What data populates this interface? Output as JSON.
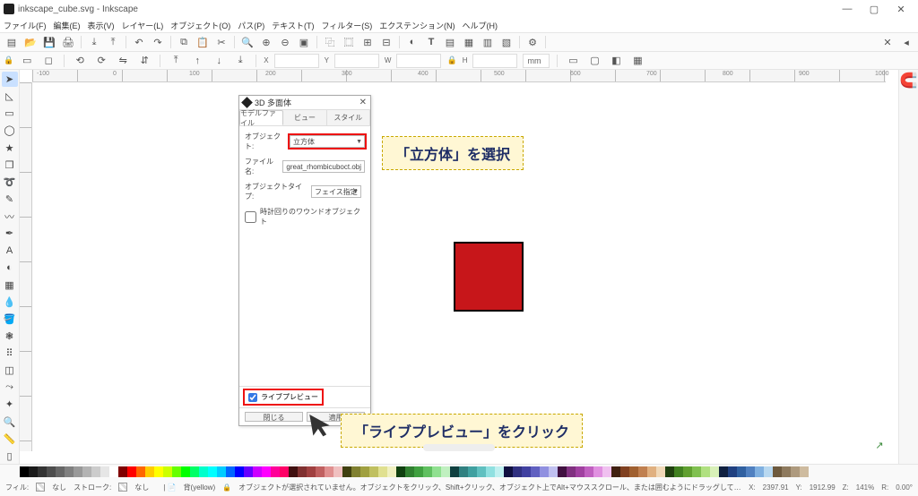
{
  "title": "inkscape_cube.svg - Inkscape",
  "menus": [
    "ファイル(F)",
    "編集(E)",
    "表示(V)",
    "レイヤー(L)",
    "オブジェクト(O)",
    "パス(P)",
    "テキスト(T)",
    "フィルター(S)",
    "エクステンション(N)",
    "ヘルプ(H)"
  ],
  "toolbar2": {
    "x_label": "X",
    "x_val": "",
    "y_label": "Y",
    "y_val": "",
    "w_label": "W",
    "w_val": "",
    "h_label": "H",
    "h_val": "",
    "unit": "mm"
  },
  "ruler_ticks": [
    "-100",
    "0",
    "100",
    "200",
    "300",
    "400",
    "500",
    "600",
    "700",
    "800",
    "900",
    "1000"
  ],
  "dialog": {
    "title": "3D 多面体",
    "tabs": [
      "モデルファイル",
      "ビュー",
      "スタイル"
    ],
    "obj_label": "オブジェクト:",
    "obj_value": "立方体",
    "file_label": "ファイル名:",
    "file_value": "great_rhombicuboct.obj",
    "type_label": "オブジェクトタイプ:",
    "type_value": "フェイス指定",
    "cw_label": "時計回りのワウンドオブジェクト",
    "live_label": "ライブプレビュー",
    "btn_close": "閉じる",
    "btn_apply": "適用"
  },
  "annot1": "「立方体」を選択",
  "annot2": "「ライブプレビュー」をクリック",
  "status": {
    "fill_label": "フィル:",
    "stroke_label": "ストローク:",
    "none1": "なし",
    "none2": "なし",
    "layer": "背(yellow)",
    "msg": "オブジェクトが選択されていません。オブジェクトをクリック、Shift+クリック、オブジェクト上でAlt+マウススクロール、または囲むようにドラッグして選択してください。",
    "coord_x": "2397.91",
    "coord_y": "1912.99",
    "zoom": "141%",
    "rot": "0.00°"
  },
  "palette_colors": [
    "#000000",
    "#1a1a1a",
    "#333333",
    "#4d4d4d",
    "#666666",
    "#808080",
    "#999999",
    "#b3b3b3",
    "#cccccc",
    "#e6e6e6",
    "#ffffff",
    "#800000",
    "#ff0000",
    "#ff6600",
    "#ffcc00",
    "#ffff00",
    "#ccff00",
    "#66ff00",
    "#00ff00",
    "#00ff66",
    "#00ffcc",
    "#00ffff",
    "#00ccff",
    "#0066ff",
    "#0000ff",
    "#6600ff",
    "#cc00ff",
    "#ff00ff",
    "#ff0099",
    "#ff0066",
    "#401010",
    "#803030",
    "#a04040",
    "#c06060",
    "#e09090",
    "#f0c0c0",
    "#404010",
    "#808030",
    "#a0a040",
    "#c0c060",
    "#e0e090",
    "#f0f0c0",
    "#104010",
    "#308030",
    "#40a040",
    "#60c060",
    "#90e090",
    "#c0f0c0",
    "#104040",
    "#308080",
    "#40a0a0",
    "#60c0c0",
    "#90e0e0",
    "#c0f0f0",
    "#101040",
    "#303080",
    "#4040a0",
    "#6060c0",
    "#9090e0",
    "#c0c0f0",
    "#401040",
    "#803080",
    "#a040a0",
    "#c060c0",
    "#e090e0",
    "#f0c0f0",
    "#402010",
    "#804020",
    "#a06030",
    "#c08050",
    "#e0b080",
    "#f0d8b8",
    "#204010",
    "#408020",
    "#60a030",
    "#80c050",
    "#b0e080",
    "#d8f0b8",
    "#102040",
    "#204080",
    "#3060a0",
    "#5080c0",
    "#80b0e0",
    "#b8d8f0",
    "#6e5a3e",
    "#8e7a5e",
    "#ae9a7e",
    "#cebb9f"
  ]
}
